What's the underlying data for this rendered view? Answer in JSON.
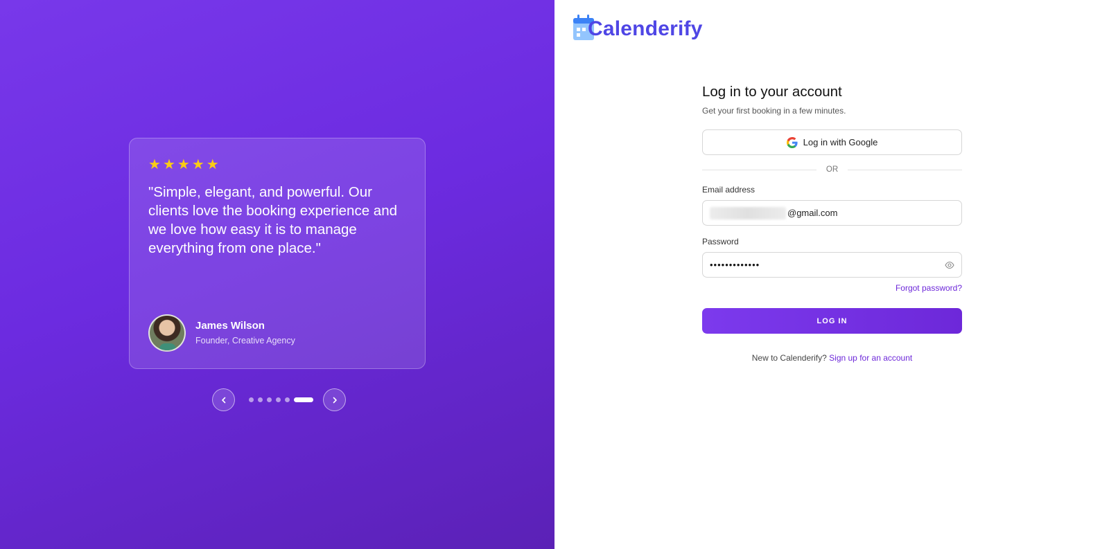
{
  "testimonial": {
    "rating": 5,
    "quote": "\"Simple, elegant, and powerful. Our clients love the booking experience and we love how easy it is to manage everything from one place.\"",
    "author_name": "James Wilson",
    "author_role": "Founder, Creative Agency"
  },
  "carousel": {
    "slide_count": 6,
    "active_index": 5,
    "prev_icon": "chevron-left-icon",
    "next_icon": "chevron-right-icon"
  },
  "brand": {
    "name": "Calenderify",
    "icon": "calendar-icon",
    "color": "#4f46e5"
  },
  "login": {
    "title": "Log in to your account",
    "subtitle": "Get your first booking in a few minutes.",
    "google_label": "Log in with Google",
    "or_label": "OR",
    "email_label": "Email address",
    "email_value_visible": "@gmail.com",
    "password_label": "Password",
    "password_value": "•••••••••••••",
    "forgot_label": "Forgot password?",
    "submit_label": "LOG IN",
    "signup_prompt": "New to Calenderify?",
    "signup_link": "Sign up for an account"
  },
  "colors": {
    "panel_gradient_start": "#7838ea",
    "panel_gradient_end": "#5b21b6",
    "accent": "#6d28d9",
    "star": "#facc15"
  }
}
